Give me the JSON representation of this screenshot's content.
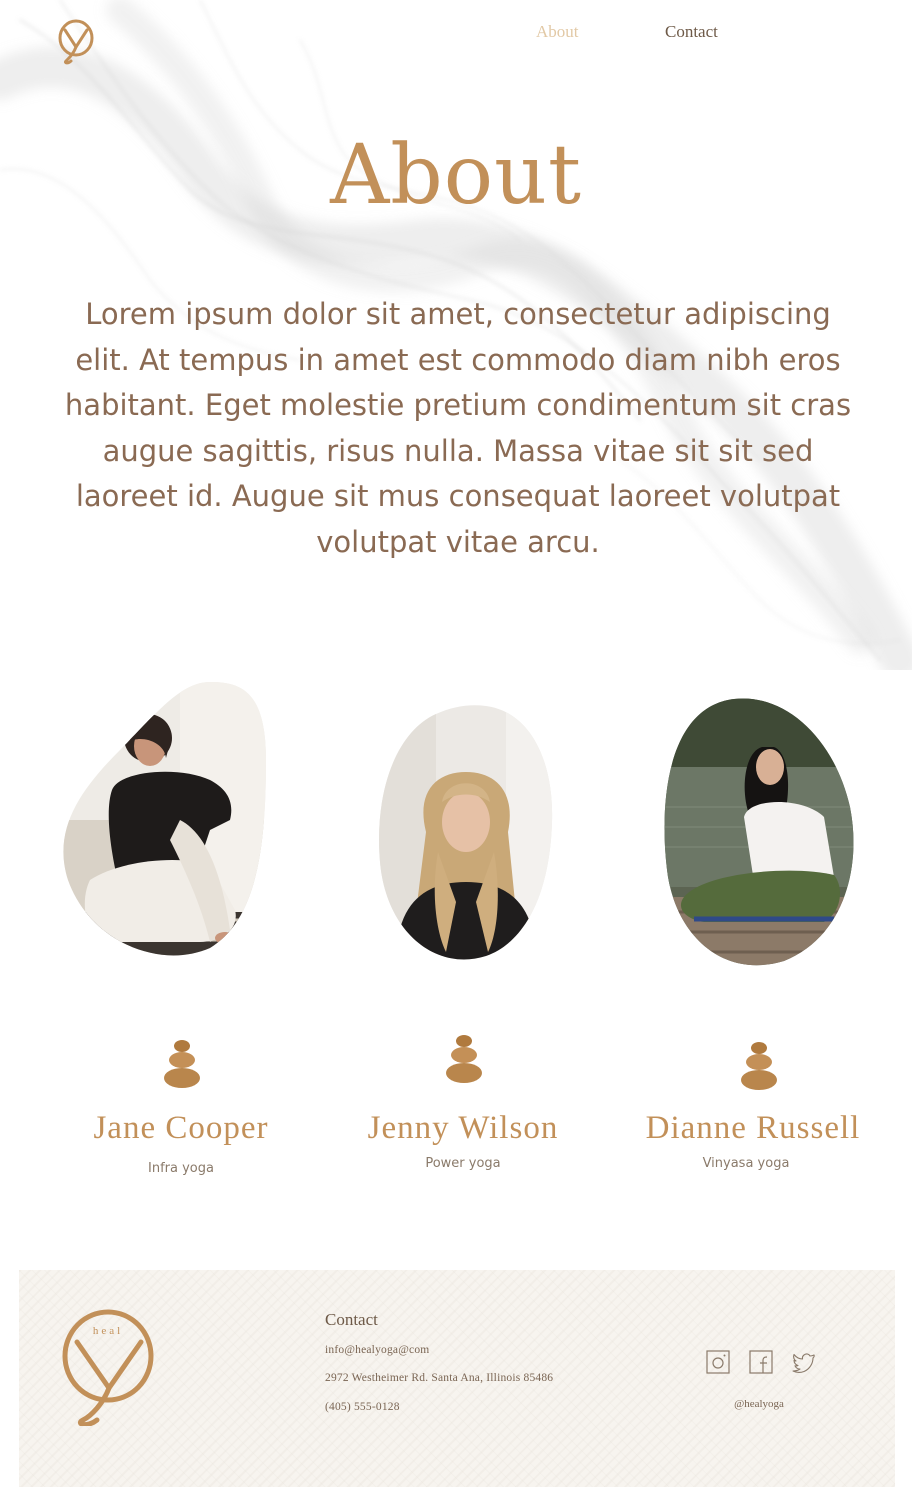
{
  "nav": {
    "about_label": "About",
    "contact_label": "Contact"
  },
  "page_title": "About",
  "intro_text": "Lorem ipsum dolor sit amet, consectetur adipiscing elit. At tempus in amet est commodo diam nibh eros habitant. Eget molestie pretium condimentum sit cras augue sagittis, risus nulla. Massa vitae sit sit sed laoreet id. Augue sit mus consequat laoreet volutpat volutpat vitae arcu.",
  "instructors": [
    {
      "name": "Jane Cooper",
      "style": "Infra yoga",
      "photo_icon": "woman-sitting-on-sofa-photo"
    },
    {
      "name": "Jenny Wilson",
      "style": "Power yoga",
      "photo_icon": "blonde-woman-portrait-photo"
    },
    {
      "name": "Dianne Russell",
      "style": "Vinyasa yoga",
      "photo_icon": "woman-meditating-by-lake-photo"
    }
  ],
  "footer": {
    "logo_text": "heal",
    "contact_heading": "Contact",
    "email": "info@healyoga@com",
    "address": "2972 Westheimer Rd. Santa Ana, Illinois 85486",
    "phone": "(405) 555-0128",
    "social_handle": "@healyoga",
    "social_icons": [
      "instagram-icon",
      "facebook-icon",
      "twitter-icon"
    ]
  },
  "colors": {
    "brand_gold": "#c29059",
    "text_brown": "#8a6a53",
    "nav_active": "#e2c9a6",
    "footer_bg": "#f7f4ef"
  }
}
